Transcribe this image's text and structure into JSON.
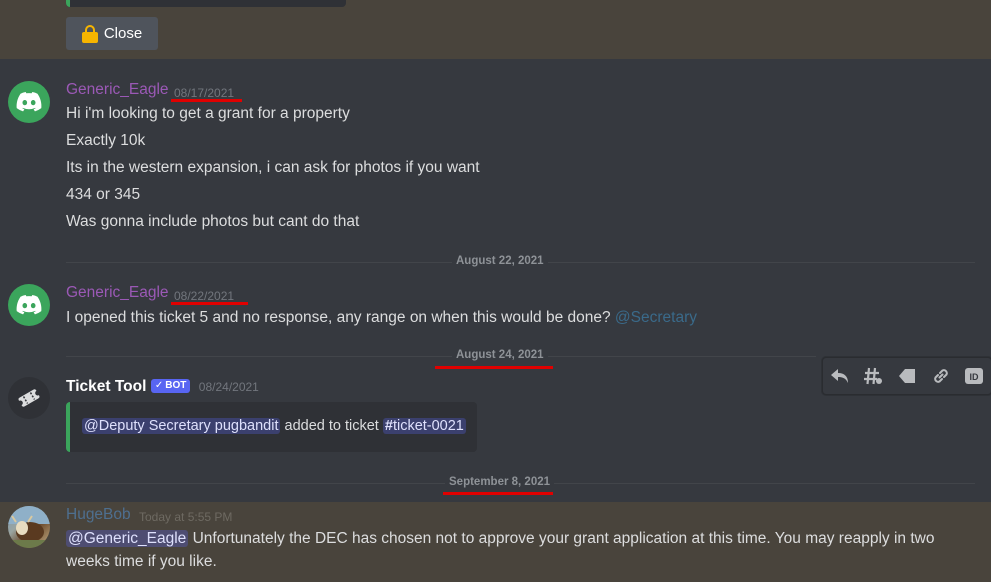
{
  "previous": {
    "close_label": "Close"
  },
  "messages": [
    {
      "username": "Generic_Eagle",
      "timestamp": "08/17/2021",
      "lines": [
        "Hi i'm looking to get a grant for a property",
        "Exactly 10k",
        "Its in the western expansion, i can ask for photos if you want",
        "434 or 345",
        "Was gonna include photos but cant do that"
      ]
    },
    {
      "username": "Generic_Eagle",
      "timestamp": "08/22/2021",
      "text": "I opened this ticket 5 and no response,  any range on when this would be done?",
      "mention": "@Secretary"
    },
    {
      "username": "Ticket Tool",
      "bot_tag": "BOT",
      "timestamp": "08/24/2021",
      "embed": {
        "mention": "@Deputy Secretary pugbandit",
        "text": "added to ticket",
        "channel": "ticket-0021"
      }
    },
    {
      "username": "HugeBob",
      "timestamp": "Today at 5:55 PM",
      "mention": "@Generic_Eagle",
      "line1": "Unfortunately the DEC has chosen not to approve your grant application at this time. You may reapply in two",
      "line2": "weeks time if you like."
    }
  ],
  "dividers": [
    "August 22, 2021",
    "August 24, 2021",
    "September 8, 2021"
  ],
  "toolbar": [
    "reply-icon",
    "thread-icon",
    "tag-icon",
    "link-icon",
    "id-icon"
  ],
  "colors": {
    "background": "#36393f",
    "highlight": "#49443c",
    "username": "#9b59b6",
    "annotation": "#e00000",
    "bot": "#5865f2"
  }
}
